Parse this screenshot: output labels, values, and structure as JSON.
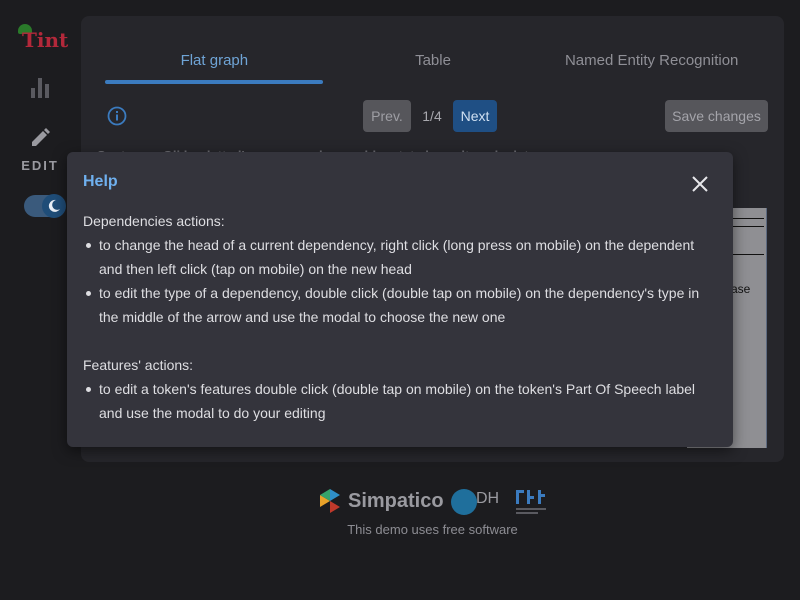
{
  "app": {
    "logo_text": "Tint"
  },
  "sidebar": {
    "edit_label": "EDIT",
    "icons": [
      "logo-icon",
      "stats-icon",
      "pencil-icon",
      "theme-toggle"
    ]
  },
  "tabs": [
    {
      "label": "Flat graph",
      "active": true
    },
    {
      "label": "Table",
      "active": false
    },
    {
      "label": "Named Entity Recognition",
      "active": false
    }
  ],
  "toolbar": {
    "prev_label": "Prev.",
    "page_indicator": "1/4",
    "next_label": "Next",
    "save_label": "Save changes"
  },
  "graph": {
    "sentence_fragment": "Sentence: Gli ha detto l'assessore che sarebbe stata la scelta ... la data per",
    "visible_label": "ase"
  },
  "help_modal": {
    "title": "Help",
    "dependencies_heading": "Dependencies actions:",
    "dependencies_items": [
      "to change the head of a current dependency, right click (long press on mobile) on the dependent and then left click (tap on mobile) on the new head",
      "to edit the type of a dependency, double click (double tap on mobile) on the dependency's type in the middle of the arrow and use the modal to choose the new one"
    ],
    "features_heading": "Features' actions:",
    "features_items": [
      "to edit a token's features double click (double tap on mobile) on the token's Part Of Speech label and use the modal to do your editing"
    ]
  },
  "footer": {
    "simpatico_label": "Simpatico",
    "dh_label": "DH",
    "note": "This demo uses free software"
  },
  "colors": {
    "accent": "#6fb0ef",
    "tab_active": "#6fa4d6",
    "next_button": "#1f4f84",
    "background": "#1c1c1f",
    "brand_red": "#b3283a"
  }
}
